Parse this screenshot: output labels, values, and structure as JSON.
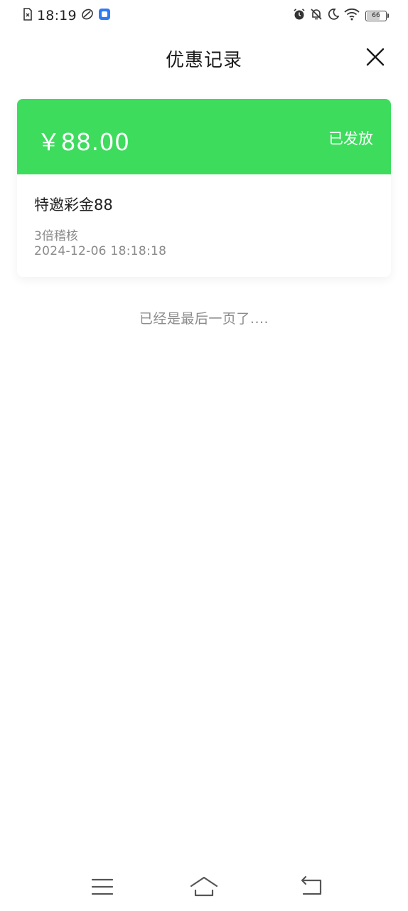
{
  "status_bar": {
    "time": "18:19",
    "battery": "66",
    "battery_level": 0.66,
    "icons": [
      "sim-error-icon",
      "app-leaf-icon",
      "app-blue-icon",
      "alarm-icon",
      "bell-off-icon",
      "moon-icon",
      "wifi-icon",
      "battery-icon"
    ]
  },
  "header": {
    "title": "优惠记录",
    "close_icon": "close-icon"
  },
  "coupon": {
    "amount": "￥88.00",
    "status": "已发放",
    "name": "特邀彩金88",
    "rule": "3倍稽核",
    "date": "2024-12-06 18:18:18",
    "accent_color": "#3ddc5d"
  },
  "list_end_text": "已经是最后一页了....",
  "nav_bar": {
    "icons": [
      "menu-icon",
      "home-icon",
      "back-icon"
    ]
  }
}
